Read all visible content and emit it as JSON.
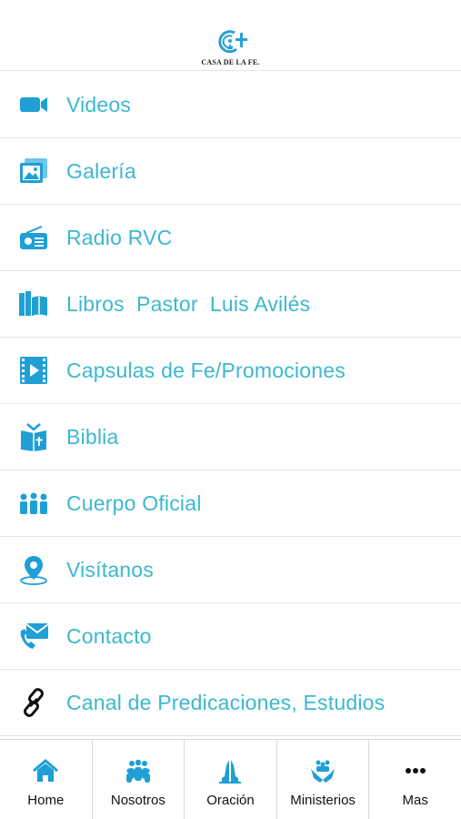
{
  "header": {
    "logo_text": "CASA DE LA FE."
  },
  "menu": [
    {
      "label": "Videos",
      "icon": "video-camera-icon"
    },
    {
      "label": "Galería",
      "icon": "gallery-icon"
    },
    {
      "label": "Radio RVC",
      "icon": "radio-icon"
    },
    {
      "label": "Libros  Pastor  Luis Avilés",
      "icon": "books-icon"
    },
    {
      "label": "Capsulas de Fe/Promociones",
      "icon": "film-play-icon"
    },
    {
      "label": "Biblia",
      "icon": "bible-icon"
    },
    {
      "label": "Cuerpo Oficial",
      "icon": "group-icon"
    },
    {
      "label": "Visítanos",
      "icon": "location-pin-icon"
    },
    {
      "label": "Contacto",
      "icon": "contact-mail-phone-icon"
    },
    {
      "label": "Canal de Predicaciones, Estudios",
      "icon": "link-icon"
    }
  ],
  "tabs": [
    {
      "label": "Home",
      "icon": "home-icon"
    },
    {
      "label": "Nosotros",
      "icon": "people-icon"
    },
    {
      "label": "Oración",
      "icon": "praying-hands-icon"
    },
    {
      "label": "Ministerios",
      "icon": "ministry-icon"
    },
    {
      "label": "Mas",
      "icon": "more-dots-icon"
    }
  ],
  "colors": {
    "accent": "#3bb8cf",
    "icon": "#1f9fd6",
    "text": "#111111"
  }
}
